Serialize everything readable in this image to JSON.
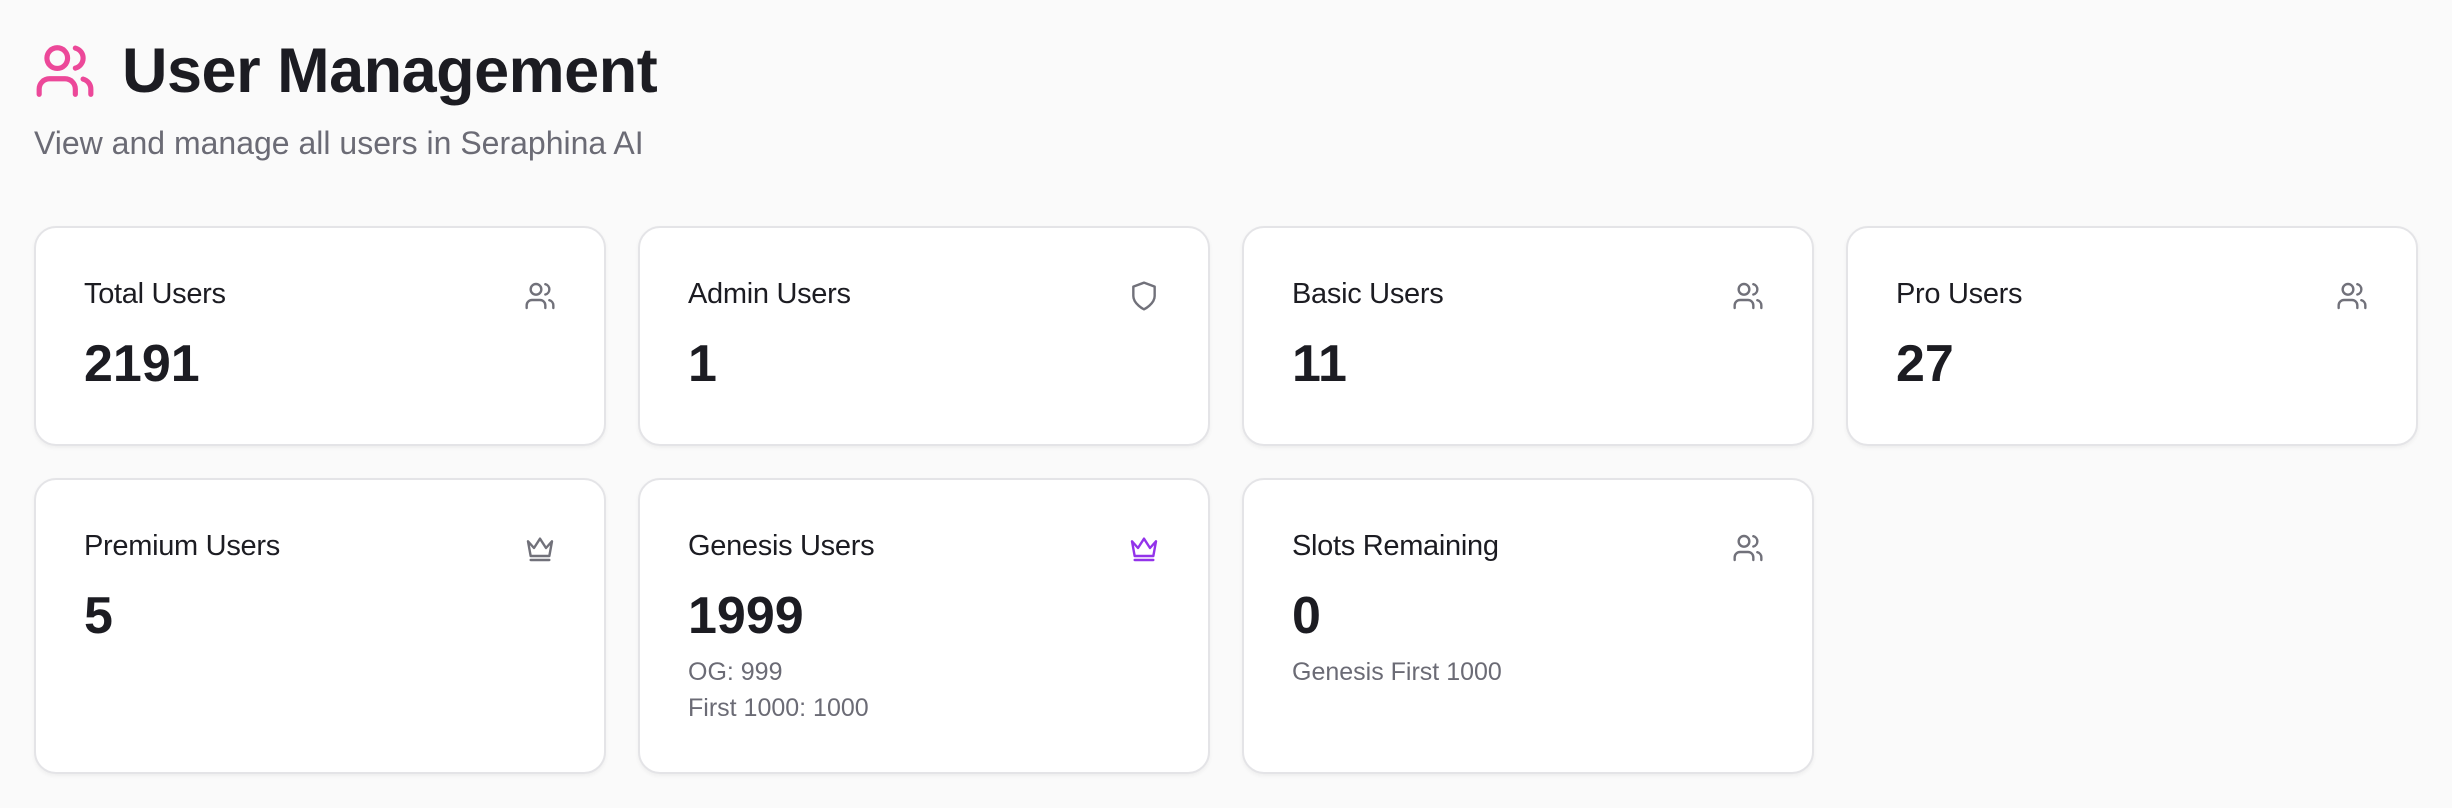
{
  "header": {
    "title": "User Management",
    "subtitle": "View and manage all users in Seraphina AI",
    "icon": "users-icon",
    "accent_color": "#ec4899"
  },
  "stats": {
    "total": {
      "label": "Total Users",
      "value": "2191",
      "icon": "users-icon"
    },
    "admin": {
      "label": "Admin Users",
      "value": "1",
      "icon": "shield-icon"
    },
    "basic": {
      "label": "Basic Users",
      "value": "11",
      "icon": "users-icon"
    },
    "pro": {
      "label": "Pro Users",
      "value": "27",
      "icon": "users-icon"
    },
    "premium": {
      "label": "Premium Users",
      "value": "5",
      "icon": "crown-icon"
    },
    "genesis": {
      "label": "Genesis Users",
      "value": "1999",
      "icon": "crown-icon",
      "icon_color": "#9333ea",
      "notes": [
        "OG: 999",
        "First 1000: 1000"
      ]
    },
    "slots": {
      "label": "Slots Remaining",
      "value": "0",
      "icon": "users-icon",
      "notes": [
        "Genesis First 1000"
      ]
    }
  }
}
